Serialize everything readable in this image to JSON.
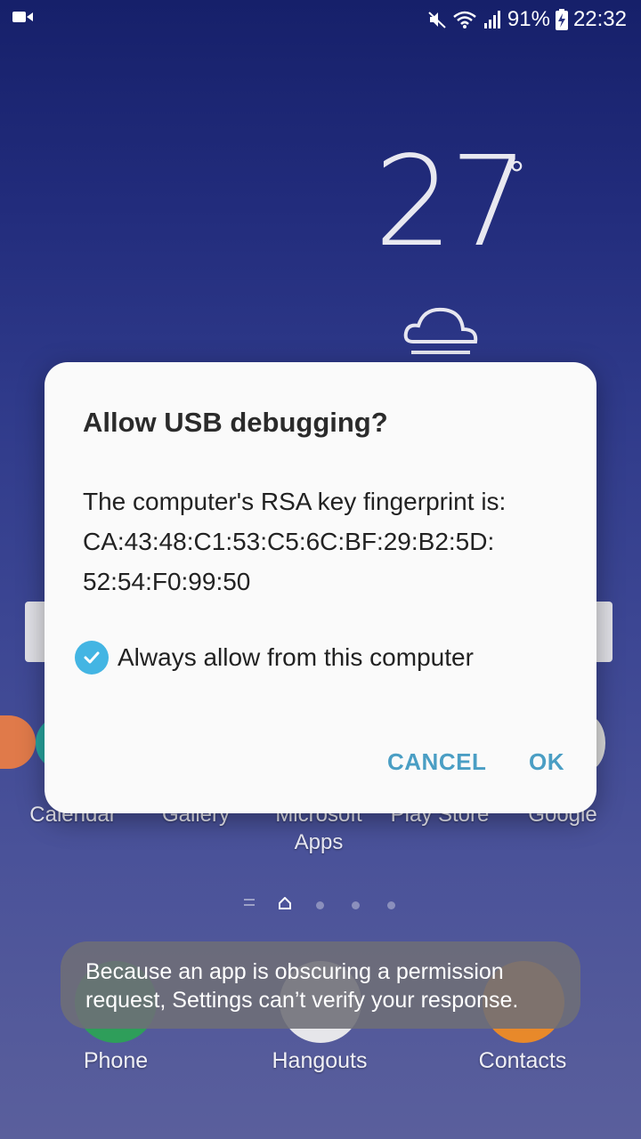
{
  "status_bar": {
    "battery": "91%",
    "time": "22:32",
    "icons": [
      "video-camera-icon",
      "mute-icon",
      "wifi-icon",
      "signal-icon",
      "battery-charging-icon"
    ]
  },
  "weather": {
    "temperature": "27",
    "degree": "°",
    "icon": "cloud-icon"
  },
  "apps_row": {
    "labels": [
      "Calendar",
      "Gallery",
      "Microsoft Apps",
      "Play Store",
      "Google"
    ]
  },
  "dock": {
    "phone_label": "Phone",
    "hangouts_label": "Hangouts",
    "contacts_label": "Contacts"
  },
  "dialog": {
    "title": "Allow USB debugging?",
    "message_line1": "The computer's RSA key fingerprint is:",
    "message_line2": "CA:43:48:C1:53:C5:6C:BF:29:B2:5D:",
    "message_line3": "52:54:F0:99:50",
    "checkbox_label": "Always allow from this computer",
    "checkbox_checked": true,
    "cancel_label": "CANCEL",
    "ok_label": "OK"
  },
  "toast": {
    "text": "Because an app is obscuring a permission request, Settings can’t verify your response."
  },
  "colors": {
    "accent": "#4a9ec4",
    "checkbox": "#43b5e3",
    "dialog_bg": "#fafafa"
  }
}
